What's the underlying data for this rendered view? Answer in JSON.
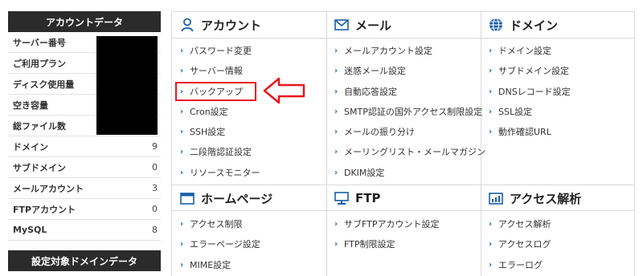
{
  "sidebar": {
    "header": "アカウントデータ",
    "rows": [
      {
        "label": "サーバー番号",
        "value": ""
      },
      {
        "label": "ご利用プラン",
        "value": ""
      },
      {
        "label": "ディスク使用量",
        "value": ""
      },
      {
        "label": "空き容量",
        "value": ""
      },
      {
        "label": "総ファイル数",
        "value": ""
      },
      {
        "label": "ドメイン",
        "value": "9"
      },
      {
        "label": "サブドメイン",
        "value": "0"
      },
      {
        "label": "メールアカウント",
        "value": "3"
      },
      {
        "label": "FTPアカウント",
        "value": "0"
      },
      {
        "label": "MySQL",
        "value": "8"
      }
    ],
    "header2": "設定対象ドメインデータ"
  },
  "sections": {
    "account": {
      "title": "アカウント",
      "icon": "user-icon",
      "links": [
        "パスワード変更",
        "サーバー情報",
        "バックアップ",
        "Cron設定",
        "SSH設定",
        "二段階認証設定",
        "リソースモニター"
      ]
    },
    "mail": {
      "title": "メール",
      "icon": "envelope-icon",
      "links": [
        "メールアカウント設定",
        "迷惑メール設定",
        "自動応答設定",
        "SMTP認証の国外アクセス制限設定",
        "メールの振り分け",
        "メーリングリスト・メールマガジン",
        "DKIM設定"
      ]
    },
    "domain": {
      "title": "ドメイン",
      "icon": "globe-icon",
      "links": [
        "ドメイン設定",
        "サブドメイン設定",
        "DNSレコード設定",
        "SSL設定",
        "動作確認URL"
      ]
    },
    "homepage": {
      "title": "ホームページ",
      "icon": "browser-window-icon",
      "links": [
        "アクセス制限",
        "エラーページ設定",
        "MIME設定"
      ]
    },
    "ftp": {
      "title": "FTP",
      "icon": "monitor-icon",
      "links": [
        "サブFTPアカウント設定",
        "FTP制限設定"
      ]
    },
    "analytics": {
      "title": "アクセス解析",
      "icon": "bar-chart-icon",
      "links": [
        "アクセス解析",
        "アクセスログ",
        "エラーログ"
      ]
    }
  },
  "colors": {
    "accent_blue": "#1a5ea8",
    "highlight_red": "#e8171b",
    "sidebar_dark": "#2b2b2b"
  }
}
